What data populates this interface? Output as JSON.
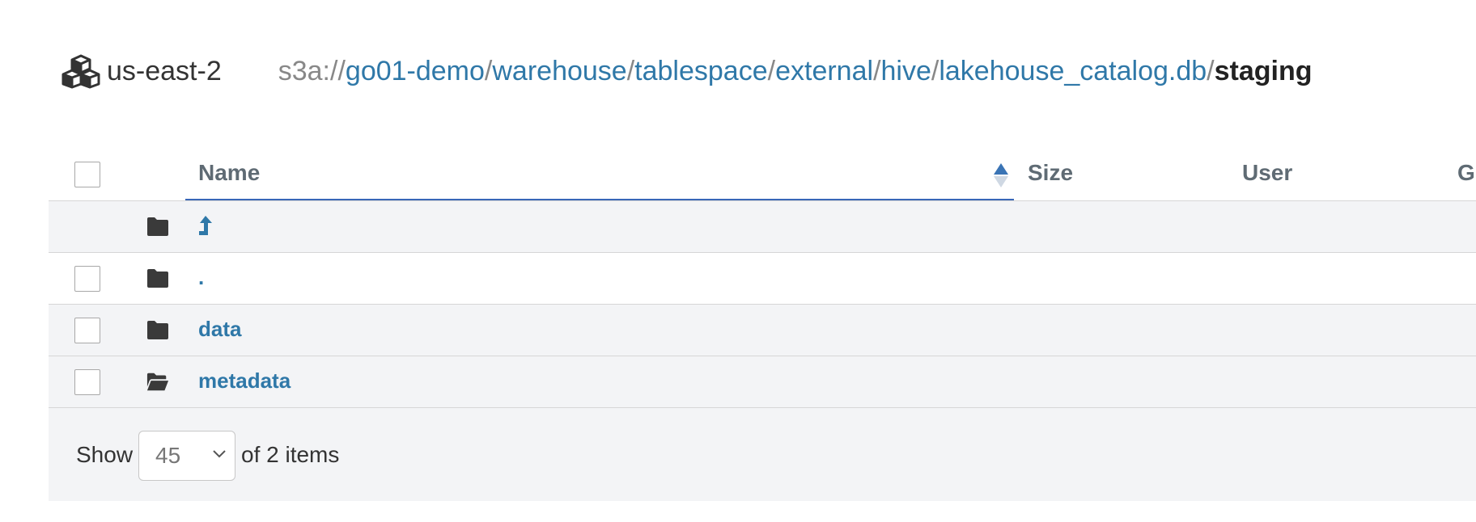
{
  "header": {
    "filesystem": "us-east-2",
    "path": {
      "scheme": "s3a://",
      "segments": [
        "go01-demo",
        "warehouse",
        "tablespace",
        "external",
        "hive",
        "lakehouse_catalog.db"
      ],
      "current": "staging",
      "separator": "/"
    }
  },
  "table": {
    "columns": {
      "name": "Name",
      "size": "Size",
      "user": "User",
      "group": "Gr"
    },
    "rows": [
      {
        "type": "parent",
        "icon": "folder-icon",
        "name": ""
      },
      {
        "type": "folder",
        "icon": "folder-icon",
        "name": "."
      },
      {
        "type": "folder",
        "icon": "folder-icon",
        "name": "data"
      },
      {
        "type": "folder",
        "icon": "folder-open-icon",
        "name": "metadata"
      }
    ]
  },
  "footer": {
    "show_label": "Show",
    "page_size": "45",
    "of_items": "of 2 items"
  },
  "colors": {
    "link": "#2f78a8",
    "sort_active": "#3867b8",
    "row_alt": "#f3f4f6",
    "header_text": "#5f6b74"
  }
}
